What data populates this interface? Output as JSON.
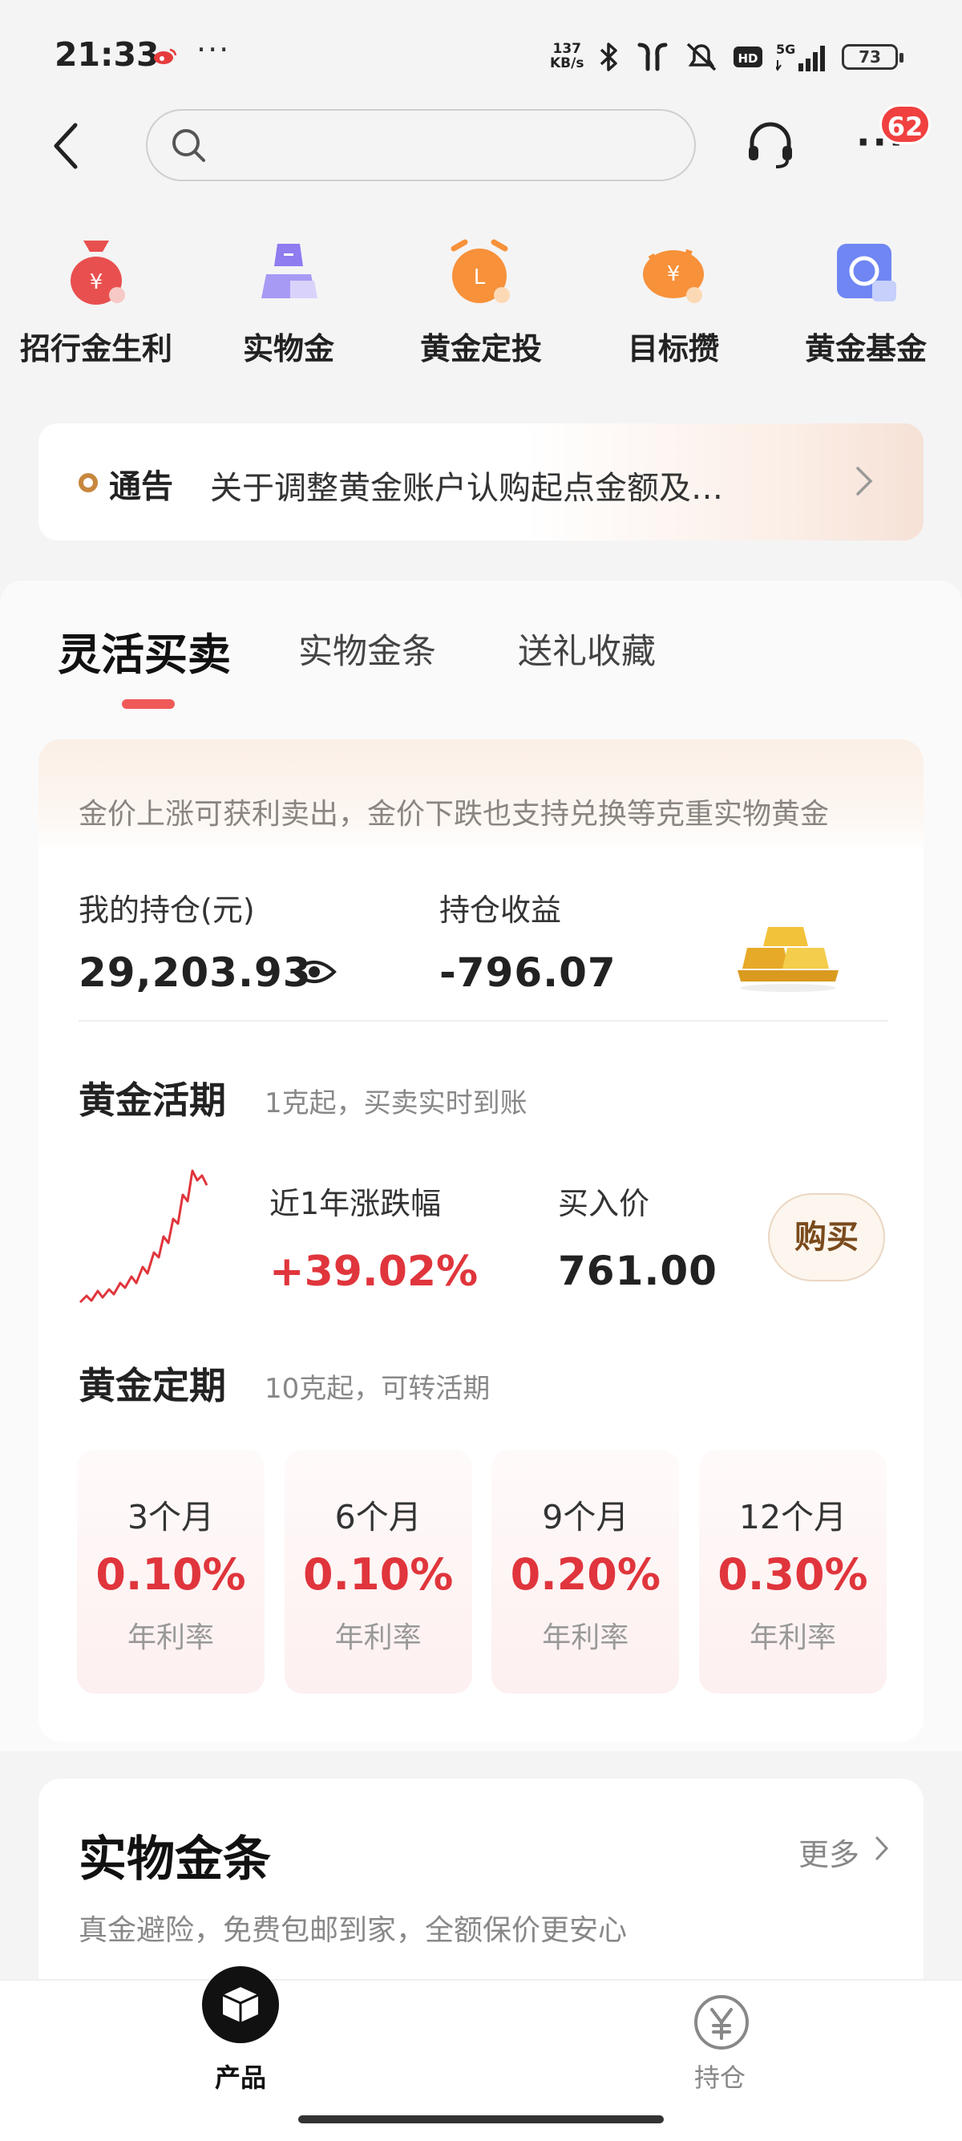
{
  "status_bar": {
    "time": "21:33",
    "net_speed_value": "137",
    "net_speed_unit": "KB/s",
    "battery": "73"
  },
  "search": {
    "placeholder": ""
  },
  "header": {
    "badge_count": "62"
  },
  "quick_entries": [
    {
      "label": "招行金生利",
      "icon": "money-bag-icon"
    },
    {
      "label": "实物金",
      "icon": "gold-bar-icon"
    },
    {
      "label": "黄金定投",
      "icon": "alarm-clock-icon"
    },
    {
      "label": "目标攒",
      "icon": "piggy-bank-icon"
    },
    {
      "label": "黄金基金",
      "icon": "fund-icon"
    }
  ],
  "notice": {
    "tag": "通告",
    "text": "关于调整黄金账户认购起点金额及…"
  },
  "tabs": [
    {
      "label": "灵活买卖"
    },
    {
      "label": "实物金条"
    },
    {
      "label": "送礼收藏"
    }
  ],
  "card": {
    "tip": "金价上涨可获利卖出，金价下跌也支持兑换等克重实物黄金",
    "holding_label": "我的持仓(元)",
    "holding_value": "29,203.93",
    "profit_label": "持仓收益",
    "profit_value": "-796.07"
  },
  "demand": {
    "title": "黄金活期",
    "subtitle": "1克起，买卖实时到账",
    "change_label": "近1年涨跌幅",
    "change_value": "+39.02%",
    "price_label": "买入价",
    "price_value": "761.00",
    "buy_label": "购买"
  },
  "fixed": {
    "title": "黄金定期",
    "subtitle": "10克起，可转活期",
    "terms": [
      {
        "name": "3个月",
        "rate": "0.10%",
        "unit": "年利率"
      },
      {
        "name": "6个月",
        "rate": "0.10%",
        "unit": "年利率"
      },
      {
        "name": "9个月",
        "rate": "0.20%",
        "unit": "年利率"
      },
      {
        "name": "12个月",
        "rate": "0.30%",
        "unit": "年利率"
      }
    ]
  },
  "bars_section": {
    "title": "实物金条",
    "more": "更多",
    "subtitle": "真金避险，免费包邮到家，全额保价更安心"
  },
  "tabbar": {
    "products": "产品",
    "holdings": "持仓"
  },
  "colors": {
    "accent_red": "#e0353c",
    "gold": "#c8873e",
    "badge_red": "#f04040"
  }
}
